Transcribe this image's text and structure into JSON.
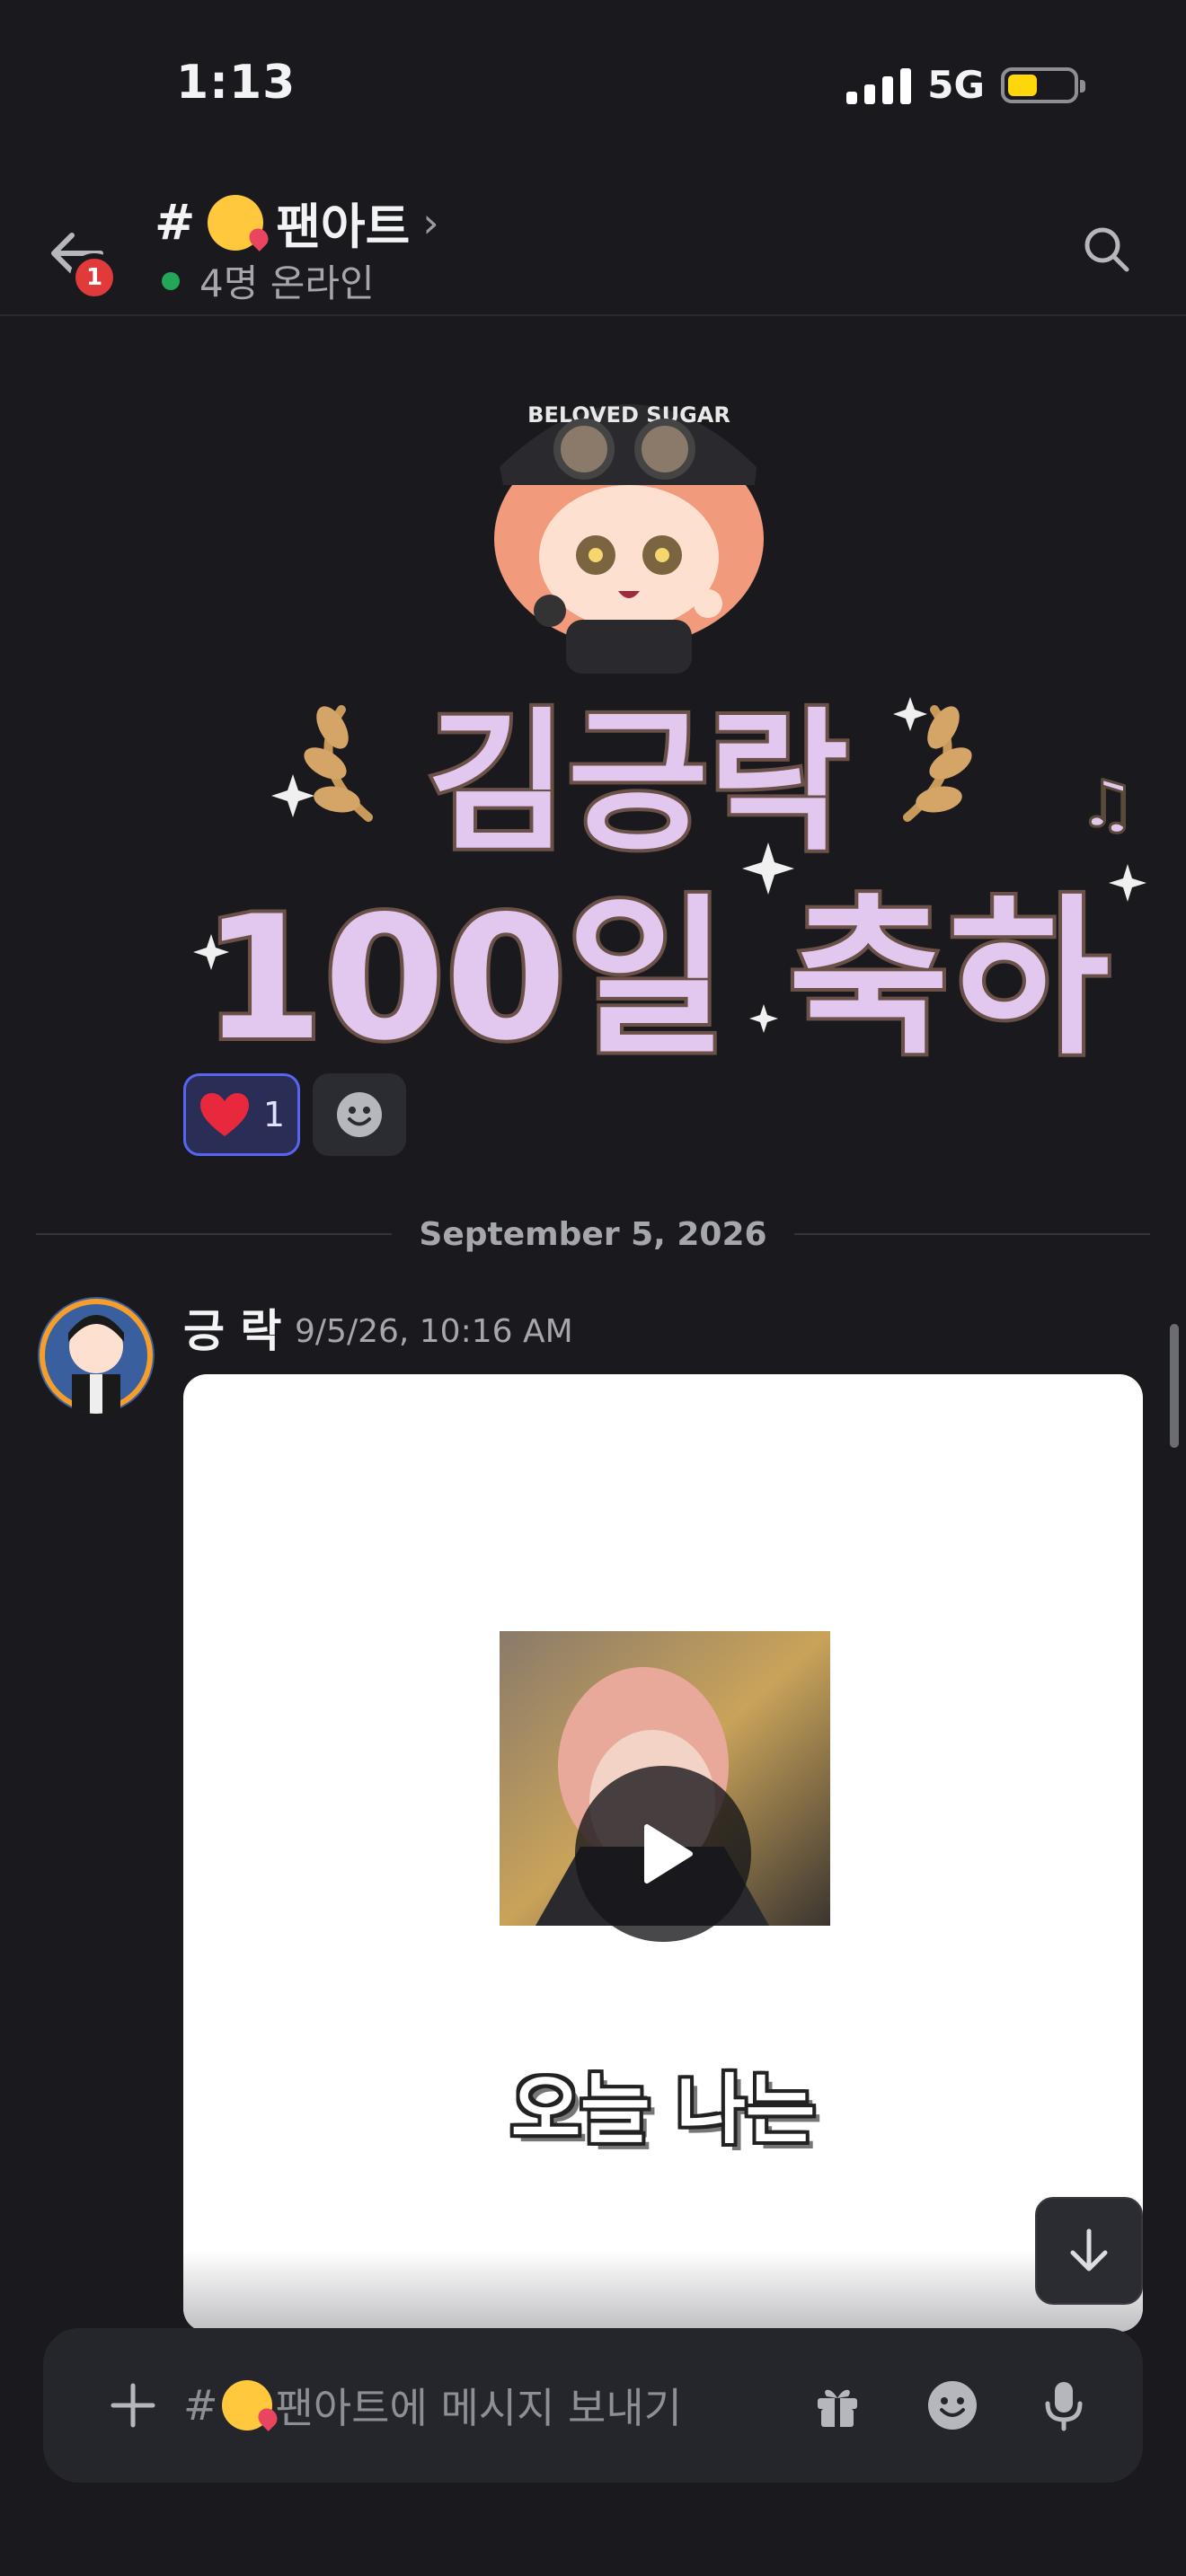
{
  "status_bar": {
    "time": "1:13",
    "network": "5G",
    "battery_level": 0.45,
    "battery_color": "#ffd60a"
  },
  "header": {
    "back_badge": "1",
    "channel_prefix": "#",
    "channel_name": "팬아트",
    "online": "4명 온라인",
    "online_color": "#23a55a"
  },
  "sticker": {
    "cap_text": "BELOVED SUGAR",
    "line1": "김긍락",
    "line2": "100일 축하"
  },
  "reactions": [
    {
      "emoji": "heart",
      "count": "1"
    }
  ],
  "date_divider": "September 5, 2026",
  "message": {
    "author": "긍 락",
    "timestamp": "9/5/26, 10:16 AM",
    "video_caption": "오늘 나는"
  },
  "composer": {
    "placeholder_prefix": "#",
    "placeholder_rest": "팬아트에 메시지 보내기"
  },
  "icons": [
    "back-arrow-icon",
    "search-icon",
    "heart-icon",
    "add-reaction-icon",
    "play-icon",
    "arrow-down-icon",
    "plus-icon",
    "gift-icon",
    "emoji-icon",
    "mic-icon"
  ],
  "colors": {
    "background": "#1a1a1e",
    "accent": "#5865f2",
    "badge": "#e03a3a",
    "sticker_text": "#e2c8ee"
  }
}
